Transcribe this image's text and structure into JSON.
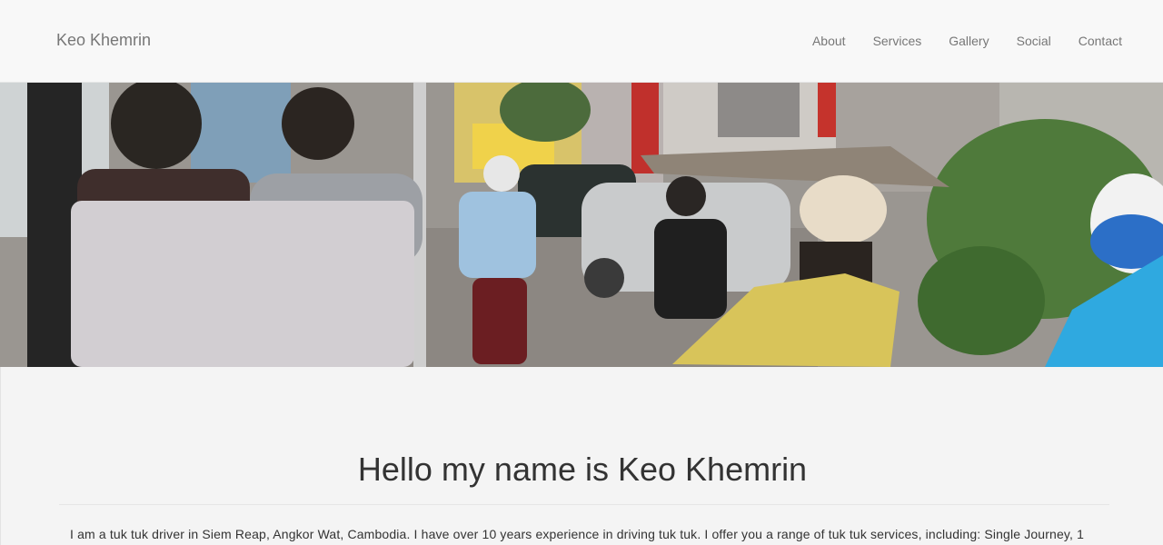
{
  "brand": "Keo Khemrin",
  "nav": {
    "items": [
      "About",
      "Services",
      "Gallery",
      "Social",
      "Contact"
    ]
  },
  "hero": {
    "photo_icon": "street-photo"
  },
  "main": {
    "heading": "Hello my name is Keo Khemrin",
    "intro": "I am a tuk tuk driver in Siem Reap, Angkor Wat, Cambodia. I have over 10 years experience in driving tuk tuk. I offer you a range of tuk tuk services, including: Single Journey, 1"
  },
  "colors": {
    "navbar_bg": "#f8f8f8",
    "nav_text": "#777777",
    "body_bg": "#f4f4f4",
    "heading_text": "#333333"
  }
}
